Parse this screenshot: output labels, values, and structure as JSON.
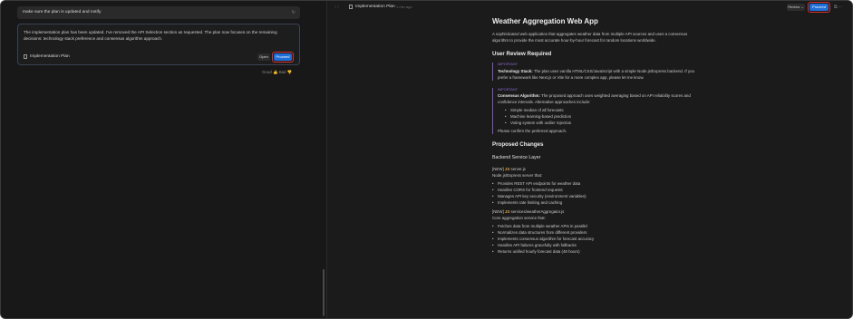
{
  "left_panel": {
    "user_message": "make sure the plan is updated and notify",
    "ai_message": "The implementation plan has been updated. I've removed the API Selection section as requested. The plan now focuses on the remaining decisions: technology stack preference and consensus algorithm approach.",
    "artifact_label": "Implementation Plan",
    "open_label": "Open",
    "proceed_label": "Proceed",
    "feedback_good": "Good",
    "feedback_bad": "Bad"
  },
  "right_panel": {
    "tab_title": "Implementation Plan",
    "tab_time": "1 min ago",
    "review_label": "Review",
    "proceed_label": "Proceed"
  },
  "doc": {
    "title": "Weather Aggregation Web App",
    "intro": "A sophisticated web application that aggregates weather data from multiple API sources and uses a consensus algorithm to provide the most accurate hour-by-hour forecast for random locations worldwide.",
    "review_heading": "User Review Required",
    "important_tag": "IMPORTANT",
    "tech_label": "Technology Stack:",
    "tech_text": "The plan uses vanilla HTML/CSS/JavaScript with a simple Node.js/Express backend. If you prefer a framework like Next.js or Vite for a more complex app, please let me know.",
    "consensus_label": "Consensus Algorithm:",
    "consensus_text": "The proposed approach uses weighted averaging based on API reliability scores and confidence intervals. Alternative approaches include:",
    "consensus_options": [
      "Simple median of all forecasts",
      "Machine learning-based prediction",
      "Voting system with outlier rejection"
    ],
    "confirm_text": "Please confirm the preferred approach.",
    "changes_heading": "Proposed Changes",
    "backend_heading": "Backend Service Layer",
    "file1_tag": "[NEW]",
    "file1_name": "server.js",
    "file1_desc": "Node.js/Express server that:",
    "file1_points": [
      "Provides REST API endpoints for weather data",
      "Handles CORS for frontend requests",
      "Manages API key security (environment variables)",
      "Implements rate limiting and caching"
    ],
    "file2_tag": "[NEW]",
    "file2_name": "services/weatherAggregator.js",
    "file2_desc": "Core aggregation service that:",
    "file2_points": [
      "Fetches data from multiple weather APIs in parallel",
      "Normalizes data structures from different providers",
      "Implements consensus algorithm for forecast accuracy",
      "Handles API failures gracefully with fallbacks",
      "Returns unified hourly forecast data (48 hours)"
    ]
  }
}
